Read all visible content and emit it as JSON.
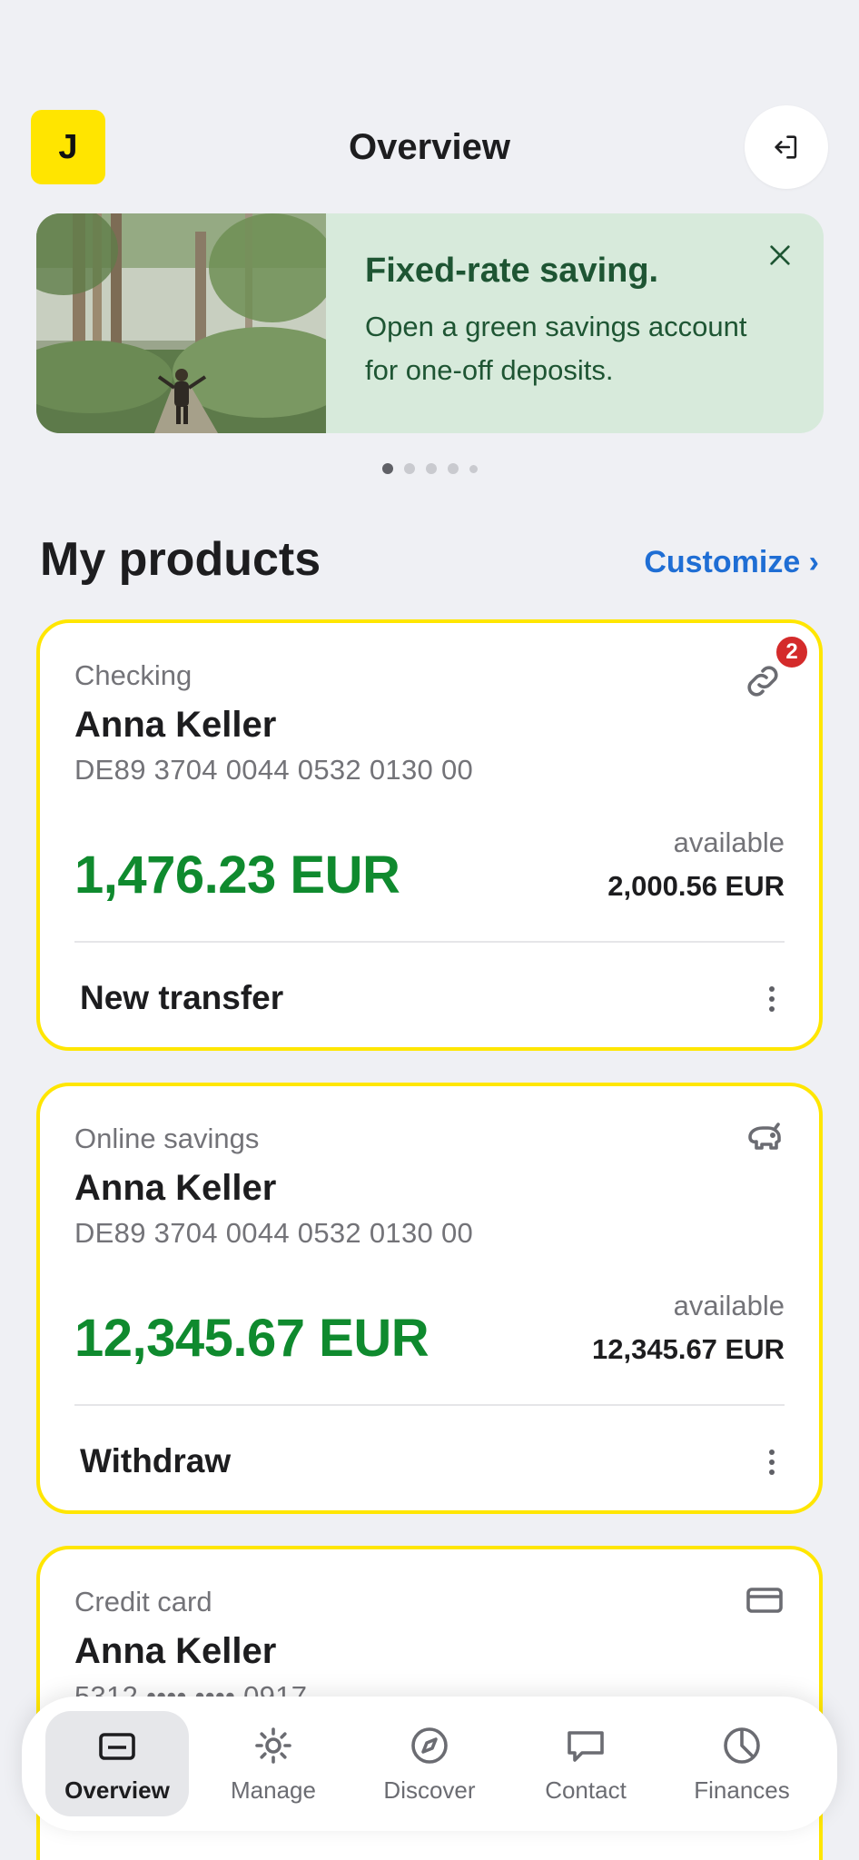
{
  "header": {
    "avatar_initial": "J",
    "title": "Overview",
    "logout_icon": "logout-icon"
  },
  "banner": {
    "title": "Fixed-rate saving.",
    "body": "Open a green savings account for one-off deposits.",
    "close_icon": "close-icon",
    "image": "forest-person-photo",
    "page_count": 5,
    "active_page": 1
  },
  "products": {
    "title": "My products",
    "customize_label": "Customize ›",
    "cards": [
      {
        "type": "Checking",
        "owner": "Anna Keller",
        "iban": "DE89 3704 0044 0532 0130 00",
        "balance": "1,476.23 EUR",
        "available_label": "available",
        "available_value": "2,000.56 EUR",
        "action": "New transfer",
        "icon": "link-icon",
        "badge": "2"
      },
      {
        "type": "Online savings",
        "owner": "Anna Keller",
        "iban": "DE89 3704 0044 0532 0130 00",
        "balance": "12,345.67 EUR",
        "available_label": "available",
        "available_value": "12,345.67 EUR",
        "action": "Withdraw",
        "icon": "piggy-bank-icon"
      },
      {
        "type": "Credit card",
        "owner": "Anna Keller",
        "iban": "5312 •••• •••• 0917",
        "icon": "credit-card-icon"
      }
    ]
  },
  "nav": {
    "items": [
      {
        "label": "Overview",
        "icon": "wallet-icon",
        "active": true
      },
      {
        "label": "Manage",
        "icon": "gear-icon"
      },
      {
        "label": "Discover",
        "icon": "compass-icon"
      },
      {
        "label": "Contact",
        "icon": "chat-icon"
      },
      {
        "label": "Finances",
        "icon": "pie-chart-icon"
      }
    ]
  },
  "colors": {
    "accent_yellow": "#ffe600",
    "balance_green": "#0f8a2e",
    "link_blue": "#1f6ed4",
    "banner_bg": "#d7eadb",
    "badge_red": "#d42b2b"
  }
}
